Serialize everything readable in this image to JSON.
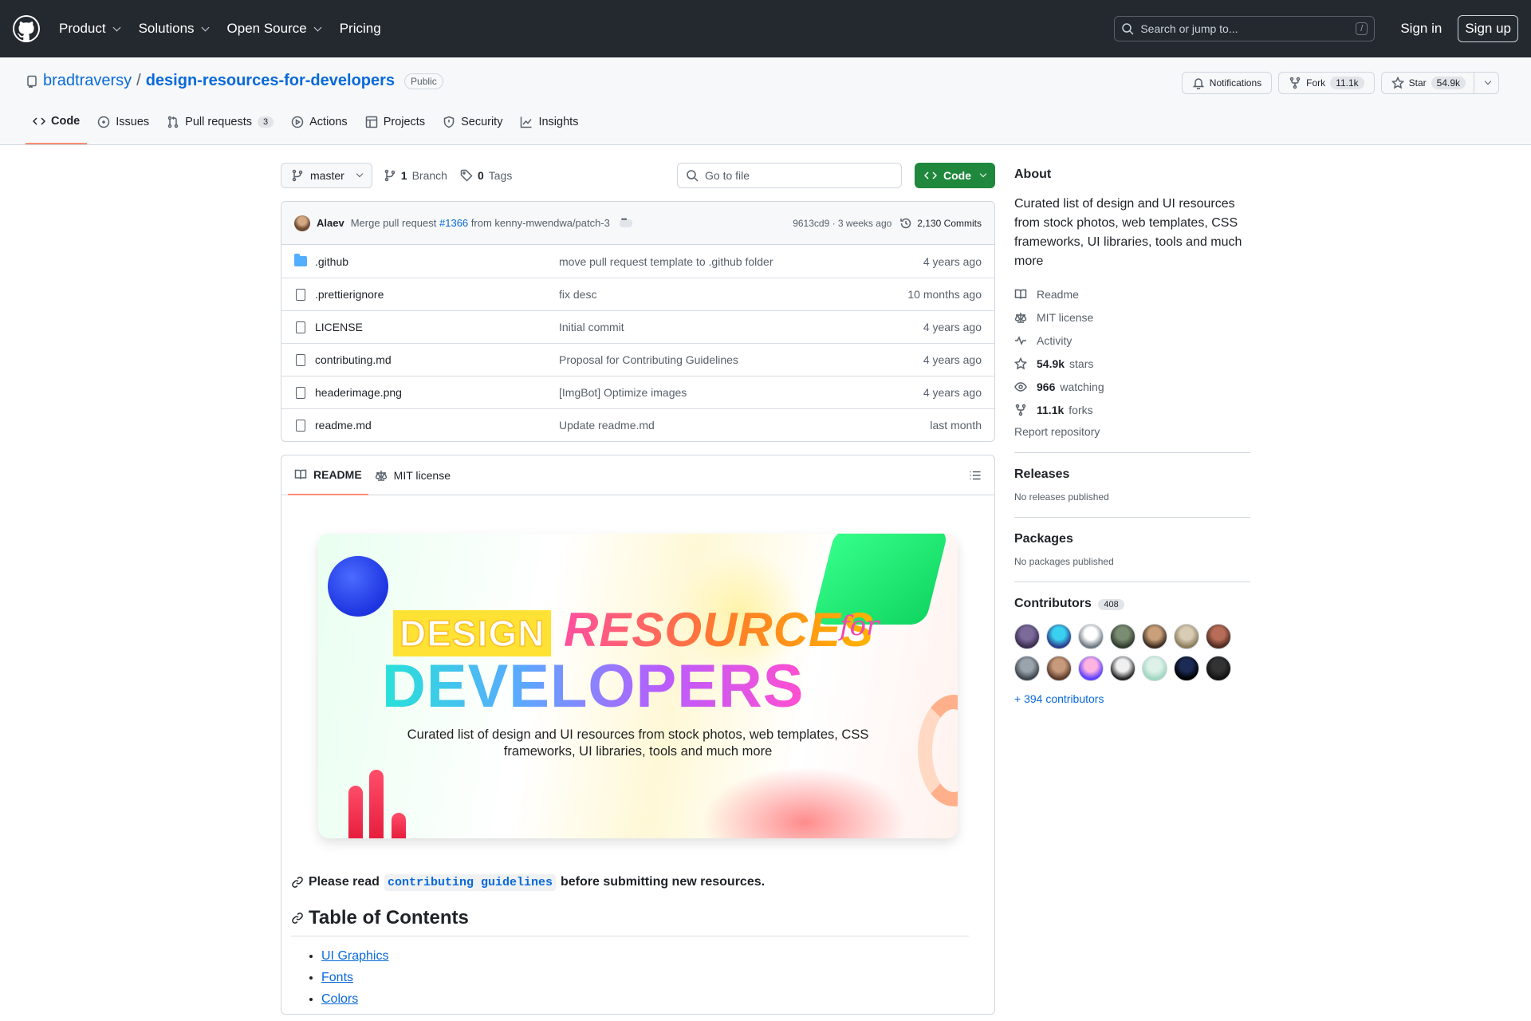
{
  "header": {
    "nav": [
      "Product",
      "Solutions",
      "Open Source",
      "Pricing"
    ],
    "search_placeholder": "Search or jump to...",
    "search_key": "/",
    "sign_in": "Sign in",
    "sign_up": "Sign up"
  },
  "repo": {
    "owner": "bradtraversy",
    "separator": "/",
    "name": "design-resources-for-developers",
    "visibility": "Public",
    "notifications": "Notifications",
    "fork_label": "Fork",
    "fork_count": "11.1k",
    "star_label": "Star",
    "star_count": "54.9k"
  },
  "tabs": [
    {
      "label": "Code",
      "icon": "code-icon",
      "active": true
    },
    {
      "label": "Issues",
      "icon": "issue-icon"
    },
    {
      "label": "Pull requests",
      "icon": "pull-request-icon",
      "count": "3"
    },
    {
      "label": "Actions",
      "icon": "play-icon"
    },
    {
      "label": "Projects",
      "icon": "table-icon"
    },
    {
      "label": "Security",
      "icon": "shield-icon"
    },
    {
      "label": "Insights",
      "icon": "graph-icon"
    }
  ],
  "toolbar": {
    "branch": "master",
    "branch_count": "1",
    "branch_label": "Branch",
    "tag_count": "0",
    "tag_label": "Tags",
    "go_to_file": "Go to file",
    "code_button": "Code"
  },
  "commit": {
    "author": "Alaev",
    "message_pre": "Merge pull request",
    "pr": "#1366",
    "message_post": "from kenny-mwendwa/patch-3",
    "sha_time": "9613cd9 · 3 weeks ago",
    "commits": "2,130 Commits"
  },
  "files": [
    {
      "name": ".github",
      "type": "folder",
      "message": "move pull request template to .github folder",
      "date": "4 years ago"
    },
    {
      "name": ".prettierignore",
      "type": "file",
      "message": "fix desc",
      "date": "10 months ago"
    },
    {
      "name": "LICENSE",
      "type": "file",
      "message": "Initial commit",
      "date": "4 years ago"
    },
    {
      "name": "contributing.md",
      "type": "file",
      "message": "Proposal for Contributing Guidelines",
      "date": "4 years ago"
    },
    {
      "name": "headerimage.png",
      "type": "file",
      "message": "[ImgBot] Optimize images",
      "date": "4 years ago"
    },
    {
      "name": "readme.md",
      "type": "file",
      "message": "Update readme.md",
      "date": "last month"
    }
  ],
  "readme": {
    "tab_readme": "README",
    "tab_license": "MIT license",
    "banner": {
      "word1": "DESIGN",
      "word2": "RESOURCES",
      "word3": "for",
      "word4": "DEVELOPERS",
      "subtitle": "Curated list of design and UI resources from stock photos, web templates, CSS frameworks, UI libraries, tools and much more"
    },
    "note_pre": "Please read",
    "note_link": "contributing guidelines",
    "note_post": "before submitting new resources.",
    "toc_heading": "Table of Contents",
    "toc": [
      "UI Graphics",
      "Fonts",
      "Colors"
    ]
  },
  "sidebar": {
    "about_heading": "About",
    "description": "Curated list of design and UI resources from stock photos, web templates, CSS frameworks, UI libraries, tools and much more",
    "readme": "Readme",
    "license": "MIT license",
    "activity": "Activity",
    "stars_count": "54.9k",
    "stars_label": "stars",
    "watching_count": "966",
    "watching_label": "watching",
    "forks_count": "11.1k",
    "forks_label": "forks",
    "report": "Report repository",
    "releases_heading": "Releases",
    "releases_note": "No releases published",
    "packages_heading": "Packages",
    "packages_note": "No packages published",
    "contributors_heading": "Contributors",
    "contributors_count": "408",
    "more_contributors": "+ 394 contributors"
  },
  "colors": {
    "accent": "#0969da",
    "header_bg": "#24292f",
    "code_button": "#1f883d",
    "active_tab": "#fd8c73"
  }
}
